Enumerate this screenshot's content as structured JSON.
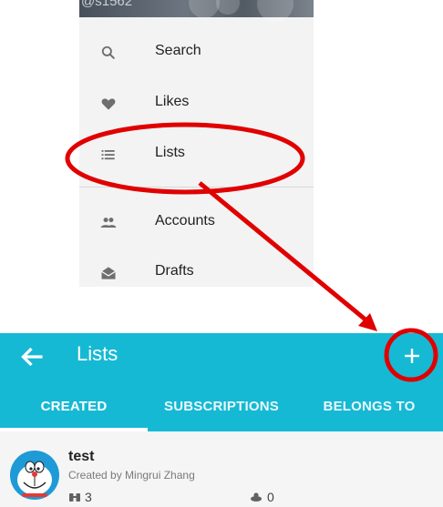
{
  "drawer": {
    "header_handle": "@s1562",
    "items": [
      {
        "label": "Search",
        "icon": "search-icon"
      },
      {
        "label": "Likes",
        "icon": "heart-icon"
      },
      {
        "label": "Lists",
        "icon": "list-icon"
      },
      {
        "label": "Accounts",
        "icon": "accounts-icon"
      },
      {
        "label": "Drafts",
        "icon": "drafts-icon"
      }
    ]
  },
  "lists_screen": {
    "title": "Lists",
    "tabs": [
      {
        "label": "CREATED",
        "selected": true
      },
      {
        "label": "SUBSCRIPTIONS",
        "selected": false
      },
      {
        "label": "BELONGS TO",
        "selected": false
      }
    ],
    "items": [
      {
        "name": "test",
        "created_by": "Created by Mingrui Zhang",
        "members": "3",
        "subscribers": "0"
      }
    ]
  },
  "colors": {
    "accent": "#16b9d4",
    "annotation": "#e00000"
  }
}
